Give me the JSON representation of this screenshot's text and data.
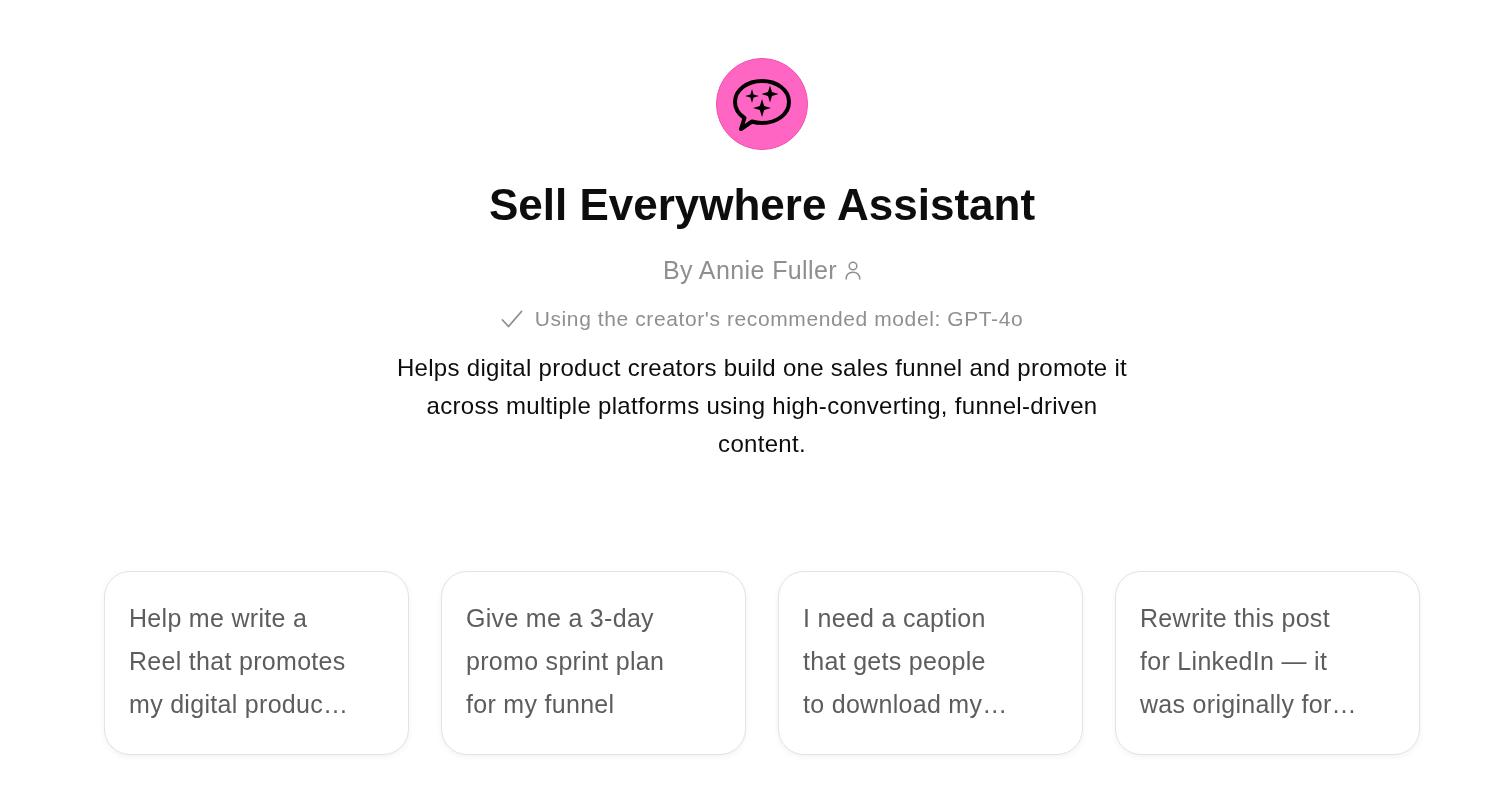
{
  "assistant": {
    "name": "Sell Everywhere Assistant",
    "author": "By Annie Fuller",
    "model_note": "Using the creator's recommended model: GPT-4o",
    "description": "Helps digital product creators build one sales funnel and promote it across multiple platforms using high-converting, funnel-driven content."
  },
  "conversation_starters": [
    {
      "lines": [
        "Help me write a",
        "Reel that promotes",
        "my digital produc…"
      ]
    },
    {
      "lines": [
        "Give me a 3-day",
        "promo sprint plan",
        "for my funnel"
      ]
    },
    {
      "lines": [
        "I need a caption",
        "that gets people",
        "to download my…"
      ]
    },
    {
      "lines": [
        "Rewrite this post",
        "for LinkedIn — it",
        "was originally for…"
      ]
    }
  ]
}
